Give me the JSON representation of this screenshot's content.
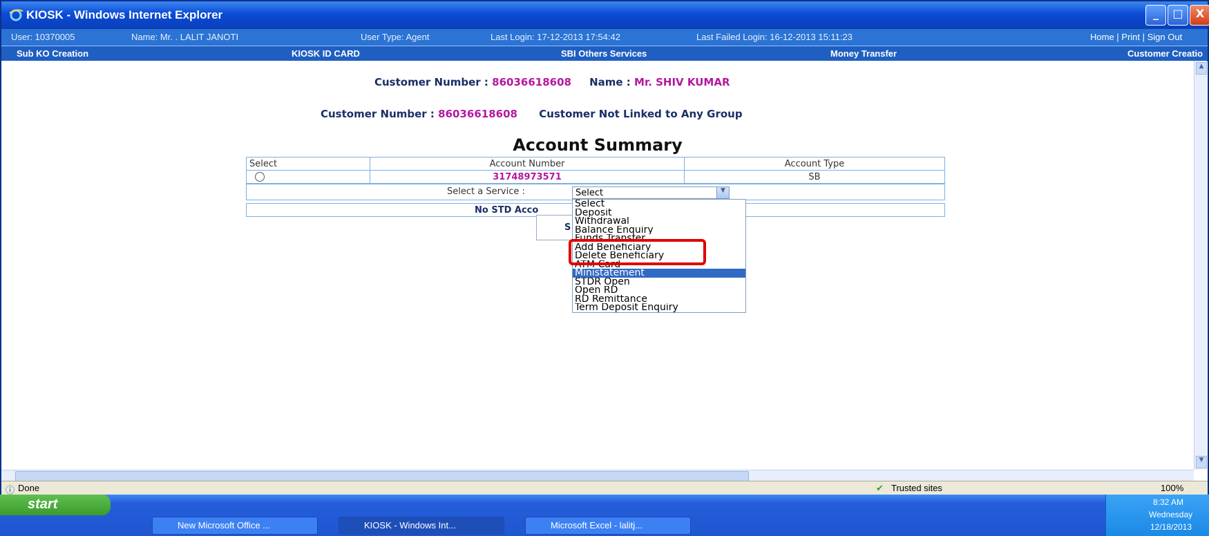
{
  "window": {
    "title": "KIOSK - Windows Internet Explorer",
    "controls": {
      "minimize": "_",
      "maximize": "□",
      "close": "X"
    }
  },
  "userbar": {
    "user": "User: 10370005",
    "name": "Name: Mr. . LALIT JANOTI",
    "user_type": "User Type: Agent",
    "last_login": "Last Login: 17-12-2013 17:54:42",
    "last_failed": "Last Failed Login: 16-12-2013 15:11:23",
    "links": "Home | Print | Sign Out"
  },
  "menu": {
    "items": [
      "Sub KO Creation",
      "KIOSK ID CARD",
      "SBI Others Services",
      "Money Transfer",
      "Customer Creatio"
    ]
  },
  "customer": {
    "number_label": "Customer Number :",
    "number": "86036618608",
    "name_label": "Name :",
    "name": "Mr. SHIV KUMAR",
    "group_status": "Customer Not Linked to Any Group"
  },
  "summary": {
    "title": "Account Summary",
    "headers": [
      "Select",
      "Account Number",
      "Account Type"
    ],
    "rows": [
      {
        "account_number": "31748973571",
        "account_type": "SB"
      }
    ],
    "service_label": "Select a Service :",
    "service_value": "Select",
    "std_text": "No STD Acco",
    "button_fragment": "S"
  },
  "dropdown": {
    "options": [
      "Select",
      "Deposit",
      "Withdrawal",
      "Balance Enquiry",
      "Funds Transfer",
      "Add Beneficiary",
      "Delete Beneficiary",
      "ATM Card",
      "Ministatement",
      "STDR Open",
      "Open RD",
      "RD Remittance",
      "Term Deposit Enquiry"
    ],
    "highlighted": "Ministatement"
  },
  "status": {
    "left": "Done",
    "zone": "Trusted sites",
    "zoom": "100%"
  },
  "taskbar": {
    "start": "start",
    "tasks": [
      "New Microsoft Office ...",
      "KIOSK - Windows Int...",
      "Microsoft Excel - lalitj..."
    ],
    "time": "8:32 AM",
    "day": "Wednesday",
    "date": "12/18/2013"
  },
  "colors": {
    "accent": "#2b73d4",
    "highlight": "#b5179e",
    "alert": "#e00000"
  }
}
